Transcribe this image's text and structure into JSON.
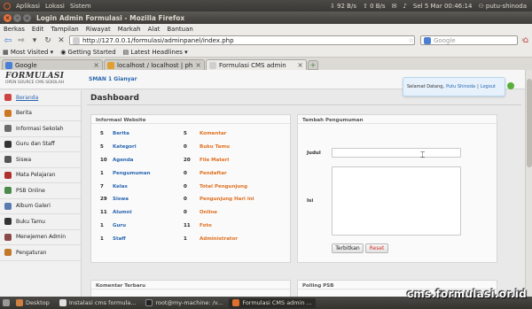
{
  "system_panel": {
    "menus": [
      "Aplikasi",
      "Lokasi",
      "Sistem"
    ],
    "net_down": "92 B/s",
    "net_up": "0 B/s",
    "clock": "Sel 5 Mar 00:46:14",
    "user": "putu-shinoda"
  },
  "window": {
    "title": "Login Admin Formulasi - Mozilla Firefox"
  },
  "ff_menu": [
    "Berkas",
    "Edit",
    "Tampilan",
    "Riwayat",
    "Markah",
    "Alat",
    "Bantuan"
  ],
  "navbar": {
    "url": "http://127.0.0.1/formulasi/adminpanel/index.php",
    "search_placeholder": "Google"
  },
  "bookmarks": [
    "Most Visited ▾",
    "Getting Started",
    "Latest Headlines ▾"
  ],
  "tabs": [
    {
      "label": "Google",
      "icon": "google-icon",
      "color": "#4a7fd6"
    },
    {
      "label": "localhost / localhost | phpM...",
      "icon": "phpmyadmin-icon",
      "color": "#e0a030"
    },
    {
      "label": "Formulasi CMS admin",
      "icon": "page-icon",
      "color": "#cfcfcf"
    }
  ],
  "header": {
    "logo": "FORMULASI",
    "logo_sub": "OPEN SOURCE CMS SEKOLAH",
    "school": "SMAN 1 Gianyar",
    "welcome_prefix": "Selamat Datang,",
    "welcome_user": "Putu Shinoda",
    "logout": "Logout"
  },
  "sidebar": [
    {
      "label": "Beranda",
      "icon": "home-icon",
      "color": "#c44"
    },
    {
      "label": "Berita",
      "icon": "news-icon",
      "color": "#cc7722"
    },
    {
      "label": "Informasi Sekolah",
      "icon": "info-icon",
      "color": "#6b6b6b"
    },
    {
      "label": "Guru dan Staff",
      "icon": "teacher-icon",
      "color": "#333333"
    },
    {
      "label": "Siswa",
      "icon": "student-icon",
      "color": "#555555"
    },
    {
      "label": "Mata Pelajaran",
      "icon": "book-icon",
      "color": "#b03030"
    },
    {
      "label": "PSB Online",
      "icon": "form-icon",
      "color": "#4a8a4a"
    },
    {
      "label": "Album Galeri",
      "icon": "gallery-icon",
      "color": "#5a7ab0"
    },
    {
      "label": "Buku Tamu",
      "icon": "guestbook-icon",
      "color": "#333333"
    },
    {
      "label": "Menejemen Admin",
      "icon": "admin-icon",
      "color": "#8a4a4a"
    },
    {
      "label": "Pengaturan",
      "icon": "wrench-icon",
      "color": "#c07a2a"
    }
  ],
  "main": {
    "title": "Dashboard",
    "info_panel_title": "Informasi Website",
    "info_rows": [
      {
        "n1": "5",
        "l1": "Berita",
        "n2": "5",
        "l2": "Komentar"
      },
      {
        "n1": "5",
        "l1": "Kategori",
        "n2": "0",
        "l2": "Buku Tamu"
      },
      {
        "n1": "10",
        "l1": "Agenda",
        "n2": "20",
        "l2": "File Materi"
      },
      {
        "n1": "1",
        "l1": "Pengumuman",
        "n2": "0",
        "l2": "Pendaftar"
      },
      {
        "n1": "7",
        "l1": "Kelas",
        "n2": "0",
        "l2": "Total Pengunjung"
      },
      {
        "n1": "29",
        "l1": "Siswa",
        "n2": "0",
        "l2": "Pengunjung Hari ini"
      },
      {
        "n1": "11",
        "l1": "Alumni",
        "n2": "0",
        "l2": "Online"
      },
      {
        "n1": "1",
        "l1": "Guru",
        "n2": "11",
        "l2": "Foto"
      },
      {
        "n1": "1",
        "l1": "Staff",
        "n2": "1",
        "l2": "Administrator"
      }
    ],
    "announce_panel_title": "Tambah Pengumuman",
    "judul_label": "Judul",
    "isi_label": "Isi",
    "submit_label": "Terbitkan",
    "reset_label": "Reset",
    "comments_panel_title": "Komentar Terbaru",
    "psb_panel_title": "Polling PSB"
  },
  "taskbar": [
    {
      "label": "Desktop",
      "icon": "desktop-icon"
    },
    {
      "label": "Instalasi cms formula...",
      "icon": "document-icon"
    },
    {
      "label": "root@my-machine: /v...",
      "icon": "terminal-icon"
    },
    {
      "label": "Formulasi CMS admin ...",
      "icon": "firefox-icon"
    }
  ],
  "watermark": "cms.formulasi.or.id"
}
